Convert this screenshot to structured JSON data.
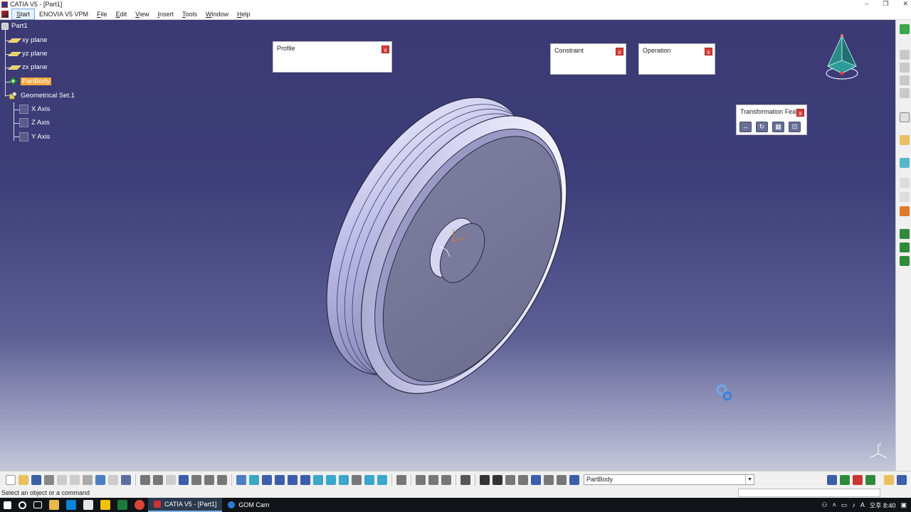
{
  "window": {
    "title": "CATIA V5 - [Part1]",
    "controls": [
      "–",
      "❐",
      "✕"
    ]
  },
  "menu": [
    {
      "label": "Start",
      "underline": "S",
      "rest": "tart",
      "active": true
    },
    {
      "label": "ENOVIA V5 VPM"
    },
    {
      "label": "File",
      "underline": "F",
      "rest": "ile"
    },
    {
      "label": "Edit",
      "underline": "E",
      "rest": "dit"
    },
    {
      "label": "View",
      "underline": "V",
      "rest": "iew"
    },
    {
      "label": "Insert",
      "underline": "I",
      "rest": "nsert"
    },
    {
      "label": "Tools",
      "underline": "T",
      "rest": "ools"
    },
    {
      "label": "Window",
      "underline": "W",
      "rest": "indow"
    },
    {
      "label": "Help",
      "underline": "H",
      "rest": "elp"
    }
  ],
  "tree": {
    "root": "Part1",
    "planes": [
      "xy plane",
      "yz plane",
      "zx plane"
    ],
    "body": "PartBody",
    "geometrical_set": "Geometrical Set.1",
    "axes": [
      "X Axis",
      "Z Axis",
      "Y Axis"
    ]
  },
  "toolbars": {
    "profile": {
      "title": "Profile",
      "close": "x"
    },
    "constraint": {
      "title": "Constraint",
      "close": "x"
    },
    "operation": {
      "title": "Operation",
      "close": "x"
    },
    "transformation": {
      "title": "Transformation Feat...",
      "close": "x",
      "icons": [
        "translation-icon",
        "rotation-icon",
        "pattern-icon",
        "scaling-icon"
      ]
    }
  },
  "current_body": "PartBody",
  "status": {
    "message": "Select an object or a command"
  },
  "taskbar": {
    "tasks": [
      {
        "label": "CATIA V5 - [Part1]",
        "active": true
      },
      {
        "label": "GOM Cam",
        "active": false
      }
    ],
    "tray": {
      "ime": "A",
      "lang": "오후 8:40"
    }
  },
  "colors": {
    "viewport_top": "#3b3a74",
    "viewport_bottom": "#c6c8da",
    "highlight": "#f4a63a",
    "close_btn": "#d4403a"
  }
}
